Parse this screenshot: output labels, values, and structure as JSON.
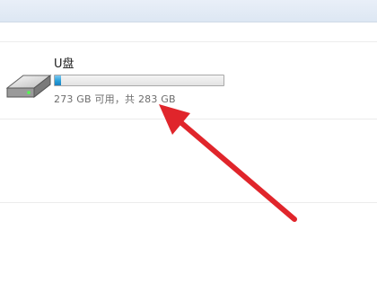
{
  "drive": {
    "name": "U盘",
    "space_text": "273 GB 可用，共 283 GB",
    "used_fraction": 0.035
  },
  "colors": {
    "arrow": "#e0252b",
    "bar_fill": "#26a0da"
  }
}
